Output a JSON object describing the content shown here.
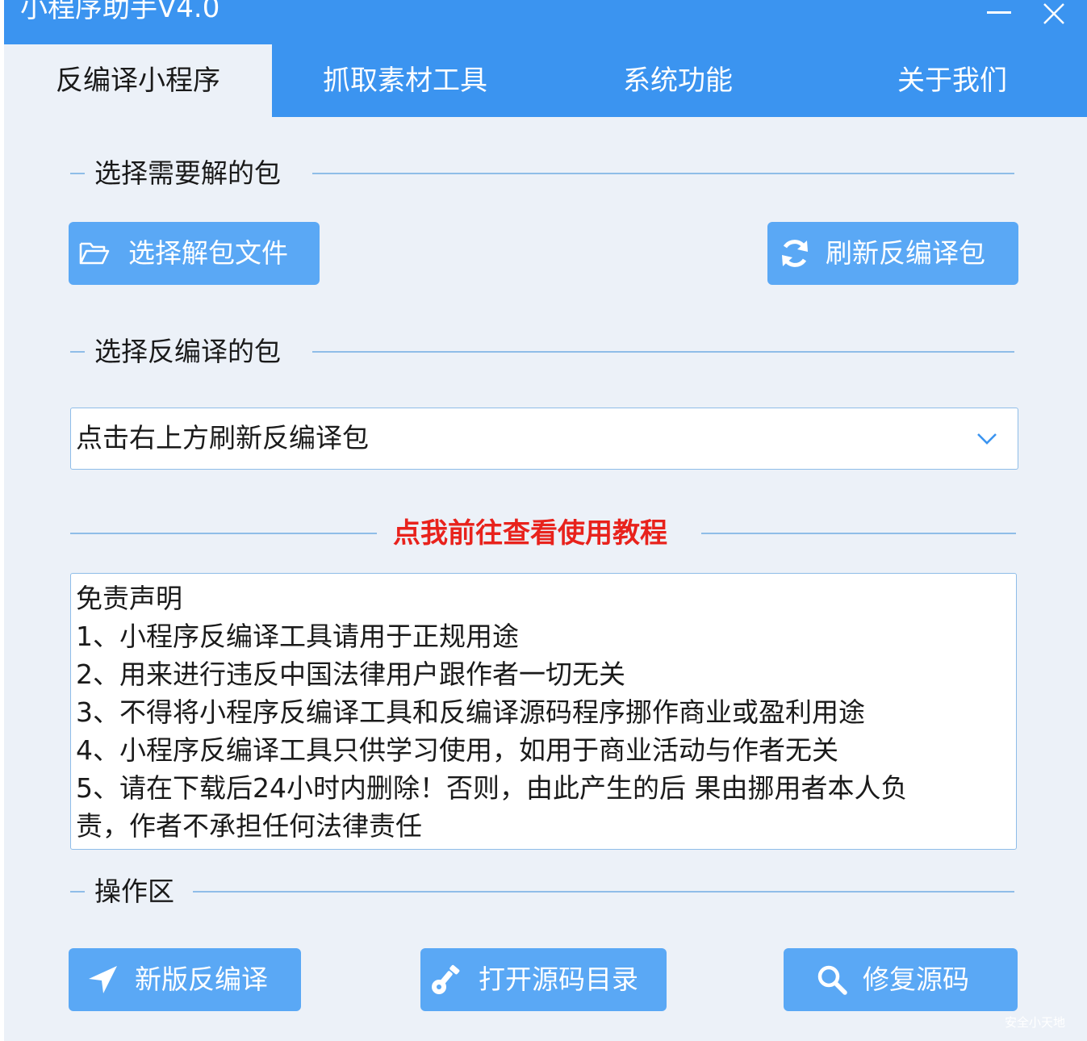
{
  "window": {
    "title": "小程序助手V4.0",
    "colors": {
      "primary": "#3b94f0",
      "button": "#5aa8f5",
      "background": "#ecf1f8",
      "link": "#e8221c"
    }
  },
  "tabs": [
    {
      "label": "反编译小程序",
      "active": true
    },
    {
      "label": "抓取素材工具",
      "active": false
    },
    {
      "label": "系统功能",
      "active": false
    },
    {
      "label": "关于我们",
      "active": false
    }
  ],
  "select_package_section": {
    "title": "选择需要解的包",
    "choose_button": {
      "label": "选择解包文件",
      "icon": "folder-open-icon"
    },
    "refresh_button": {
      "label": "刷新反编译包",
      "icon": "refresh-icon"
    }
  },
  "decompile_section": {
    "title": "选择反编译的包",
    "dropdown": {
      "value": "点击右上方刷新反编译包",
      "icon": "chevron-down-icon"
    }
  },
  "tutorial_link": "点我前往查看使用教程",
  "disclaimer": {
    "lines": [
      "免责声明",
      " 1、小程序反编译工具请用于正规用途",
      " 2、用来进行违反中国法律用户跟作者一切无关",
      " 3、不得将小程序反编译工具和反编译源码程序挪作商业或盈利用途",
      " 4、小程序反编译工具只供学习使用，如用于商业活动与作者无关",
      " 5、请在下载后24小时内删除！否则，由此产生的后 果由挪用者本人负",
      "责，作者不承担任何法律责任"
    ]
  },
  "operation_section": {
    "title": "操作区",
    "buttons": [
      {
        "label": "新版反编译",
        "icon": "send-icon"
      },
      {
        "label": "打开源码目录",
        "icon": "key-icon"
      },
      {
        "label": "修复源码",
        "icon": "search-icon"
      }
    ]
  },
  "watermark": "安全小天地"
}
